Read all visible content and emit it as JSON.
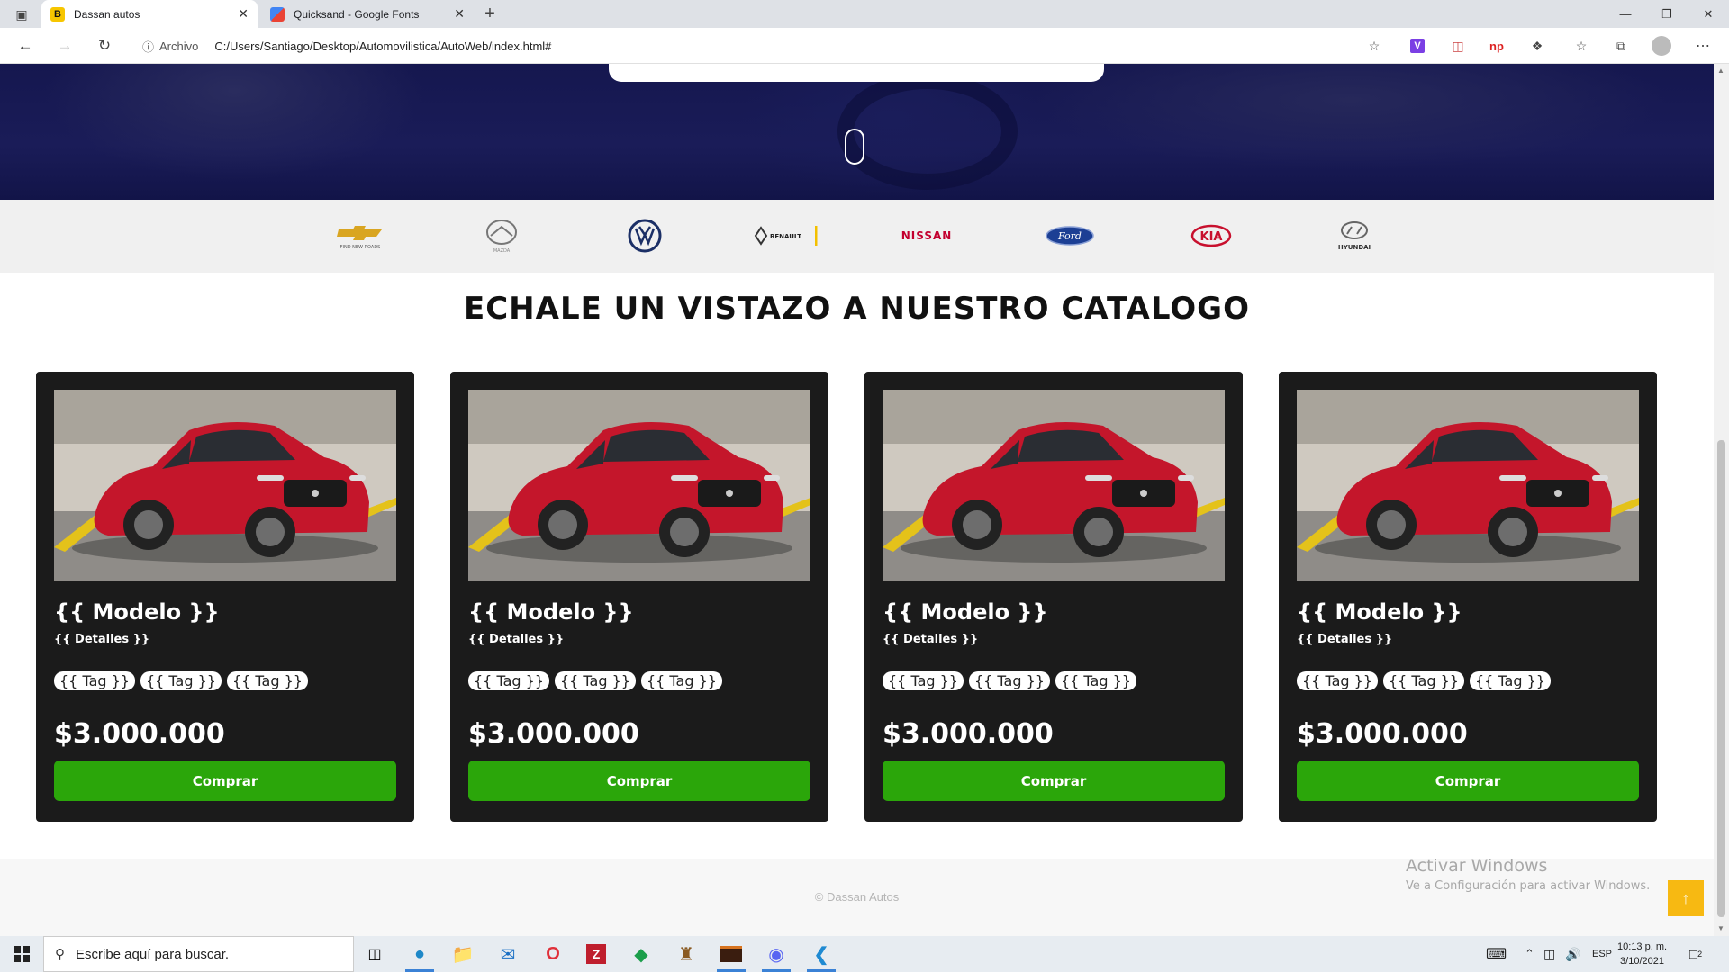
{
  "browser": {
    "tabs": [
      {
        "title": "Dassan autos",
        "favicon": "B"
      },
      {
        "title": "Quicksand - Google Fonts"
      }
    ],
    "address": {
      "protocol_label": "Archivo",
      "url": "C:/Users/Santiago/Desktop/Automovilistica/AutoWeb/index.html#"
    }
  },
  "brands": [
    "Chevrolet",
    "Mazda",
    "Volkswagen",
    "Renault",
    "Nissan",
    "Ford",
    "Kia",
    "Hyundai"
  ],
  "brand_marks": {
    "chevrolet_tagline": "FIND NEW ROADS",
    "mazda_word": "MAZDA",
    "renault_word": "RENAULT",
    "nissan_word": "NISSAN",
    "ford_word": "Ford",
    "kia_word": "KIA",
    "hyundai_word": "HYUNDAI"
  },
  "catalog": {
    "title": "ECHALE UN VISTAZO A NUESTRO CATALOGO",
    "cards": [
      {
        "model": "{{ Modelo }}",
        "details": "{{ Detalles }}",
        "tags": [
          "{{ Tag }}",
          "{{ Tag }}",
          "{{ Tag }}"
        ],
        "price": "$3.000.000",
        "button": "Comprar"
      },
      {
        "model": "{{ Modelo }}",
        "details": "{{ Detalles }}",
        "tags": [
          "{{ Tag }}",
          "{{ Tag }}",
          "{{ Tag }}"
        ],
        "price": "$3.000.000",
        "button": "Comprar"
      },
      {
        "model": "{{ Modelo }}",
        "details": "{{ Detalles }}",
        "tags": [
          "{{ Tag }}",
          "{{ Tag }}",
          "{{ Tag }}"
        ],
        "price": "$3.000.000",
        "button": "Comprar"
      },
      {
        "model": "{{ Modelo }}",
        "details": "{{ Detalles }}",
        "tags": [
          "{{ Tag }}",
          "{{ Tag }}",
          "{{ Tag }}"
        ],
        "price": "$3.000.000",
        "button": "Comprar"
      }
    ]
  },
  "footer": {
    "copyright": "© Dassan Autos"
  },
  "windows_activation": {
    "line1": "Activar Windows",
    "line2": "Ve a Configuración para activar Windows."
  },
  "taskbar": {
    "search_placeholder": "Escribe aquí para buscar.",
    "language": "ESP",
    "time": "10:13 p. m.",
    "date": "3/10/2021",
    "notification_count": "2"
  },
  "colors": {
    "buy_button": "#2ba60a",
    "card_bg": "#1b1b1b",
    "to_top": "#f7b912",
    "hero": "#1a1c58"
  }
}
